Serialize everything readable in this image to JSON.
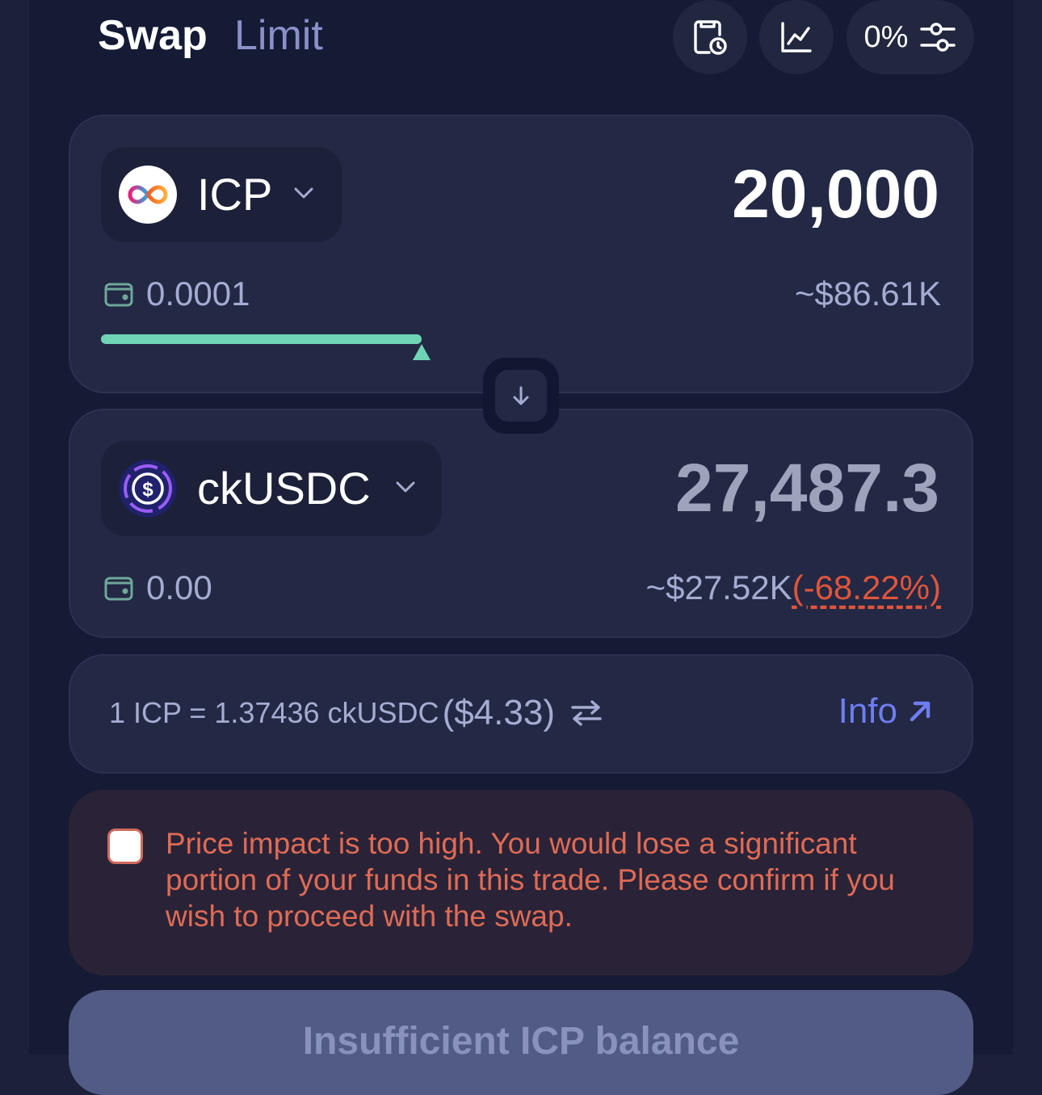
{
  "tabs": {
    "swap": "Swap",
    "limit": "Limit"
  },
  "toolbar": {
    "slippage": "0%"
  },
  "from": {
    "token": "ICP",
    "amount": "20,000",
    "balance": "0.0001",
    "usd": "~$86.61K",
    "slider_fill": 0.38
  },
  "to": {
    "token": "ckUSDC",
    "amount": "27,487.3",
    "balance": "0.00",
    "usd": "~$27.52K",
    "impact": "(-68.22%)"
  },
  "rate": {
    "text": "1 ICP = 1.37436 ckUSDC",
    "usd": "($4.33)",
    "info_label": "Info"
  },
  "warning": {
    "text": "Price impact is too high. You would lose a significant portion of your funds in this trade. Please confirm if you wish to proceed with the swap."
  },
  "cta": {
    "label": "Insufficient ICP balance"
  },
  "colors": {
    "accent": "#6e7df0",
    "slider": "#6fd4b5",
    "warning": "#df6b55",
    "impact": "#e0553b"
  }
}
